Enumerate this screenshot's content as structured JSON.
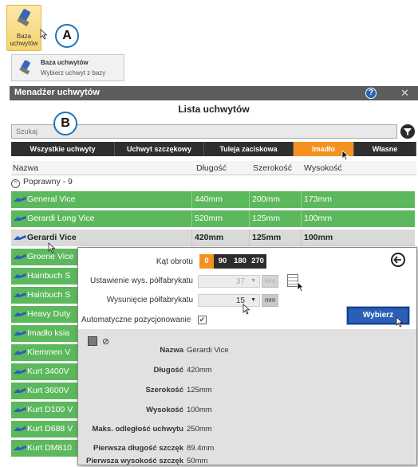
{
  "ribbon": {
    "button_label": "Baza\nuchwytów",
    "icon": "vise-icon"
  },
  "callouts": {
    "a": "A",
    "b": "B"
  },
  "tooltip": {
    "title": "Baza uchwytów",
    "description": "Wybierz uchwyt z bazy"
  },
  "window": {
    "title": "Menadżer uchwytów",
    "help": "?",
    "close": "✕",
    "subtitle": "Lista uchwytów",
    "search_placeholder": "Szukaj",
    "tabs": [
      "Wszystkie uchwyty",
      "Uchwyt szczękowy",
      "Tuleja zaciskowa",
      "Imadło",
      "Własne"
    ],
    "active_tab": "Imadło",
    "columns": {
      "name": "Nazwa",
      "length": "Długość",
      "width": "Szerokość",
      "height": "Wysokość"
    },
    "group": {
      "label": "Poprawny - 9",
      "toggle": "^"
    },
    "rows": [
      {
        "name": "General Vice",
        "length": "440mm",
        "width": "200mm",
        "height": "173mm"
      },
      {
        "name": "Gerardi Long Vice",
        "length": "520mm",
        "width": "125mm",
        "height": "100mm"
      },
      {
        "name": "Gerardi Vice",
        "length": "420mm",
        "width": "125mm",
        "height": "100mm"
      },
      {
        "name": "Groene Vice",
        "length": "",
        "width": "",
        "height": ""
      },
      {
        "name": "Hainbuch S",
        "length": "",
        "width": "",
        "height": ""
      },
      {
        "name": "Hainbuch S",
        "length": "",
        "width": "",
        "height": ""
      },
      {
        "name": "Heavy Duty",
        "length": "",
        "width": "",
        "height": ""
      },
      {
        "name": "Imadło ksia",
        "length": "",
        "width": "",
        "height": ""
      },
      {
        "name": "Klemmen V",
        "length": "",
        "width": "",
        "height": ""
      },
      {
        "name": "Kurt 3400V",
        "length": "",
        "width": "",
        "height": ""
      },
      {
        "name": "Kurt 3600V",
        "length": "",
        "width": "",
        "height": ""
      },
      {
        "name": "Kurt D100 V",
        "length": "",
        "width": "",
        "height": ""
      },
      {
        "name": "Kurt D688 V",
        "length": "",
        "width": "",
        "height": ""
      },
      {
        "name": "Kurt DM810",
        "length": "",
        "width": "",
        "height": ""
      }
    ]
  },
  "popup": {
    "rotation_label": "Kąt obrotu",
    "rotation_options": [
      "0",
      "90",
      "180",
      "270"
    ],
    "rotation_selected": "0",
    "stock_height_label": "Ustawienie wys. półfabrykatu",
    "stock_height_value": "37",
    "stock_offset_label": "Wysunięcie półfabrykatu",
    "stock_offset_value": "15",
    "unit": "mm",
    "auto_position_label": "Automatyczne pozycjonowanie",
    "auto_position_checked": "✔",
    "select_button": "Wybierz",
    "details": [
      {
        "key": "Nazwa",
        "value": "Gerardi Vice"
      },
      {
        "key": "Długość",
        "value": "420mm"
      },
      {
        "key": "Szerokość",
        "value": "125mm"
      },
      {
        "key": "Wysokość",
        "value": "100mm"
      },
      {
        "key": "Maks. odległość uchwytu",
        "value": "250mm"
      },
      {
        "key": "Pierwsza długość szczęk",
        "value": "89.4mm"
      },
      {
        "key": "Pierwsza wysokość szczęk",
        "value": "50mm"
      }
    ]
  },
  "colors": {
    "green_row": "#5cb85c",
    "accent_orange": "#f39220",
    "title_bar": "#5d5d5d",
    "button_blue": "#2a5fb8"
  }
}
